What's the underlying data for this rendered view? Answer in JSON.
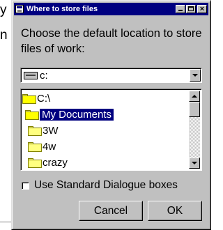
{
  "background": {
    "fragments": [
      "y",
      "n"
    ]
  },
  "dialog": {
    "title": "Where to store files",
    "titlebar_buttons": {
      "minimize": "minimize-icon",
      "maximize": "maximize-icon",
      "close": "×"
    },
    "prompt": "Choose the default location to store files of work:",
    "drive": {
      "value": "c:",
      "icon": "drive-icon"
    },
    "folders": [
      {
        "label": "C:\\",
        "icon": "open-folder-icon",
        "selected": false
      },
      {
        "label": "My Documents",
        "icon": "open-folder-icon",
        "selected": true
      },
      {
        "label": "3W",
        "icon": "folder-icon",
        "selected": false
      },
      {
        "label": "4w",
        "icon": "folder-icon",
        "selected": false
      },
      {
        "label": "crazy",
        "icon": "folder-icon",
        "selected": false
      }
    ],
    "checkbox": {
      "label": "Use Standard Dialogue boxes",
      "checked": false
    },
    "buttons": {
      "cancel": "Cancel",
      "ok": "OK"
    }
  },
  "colors": {
    "titlebar": "#000080",
    "face": "#c0c0c0",
    "selection": "#000080"
  }
}
